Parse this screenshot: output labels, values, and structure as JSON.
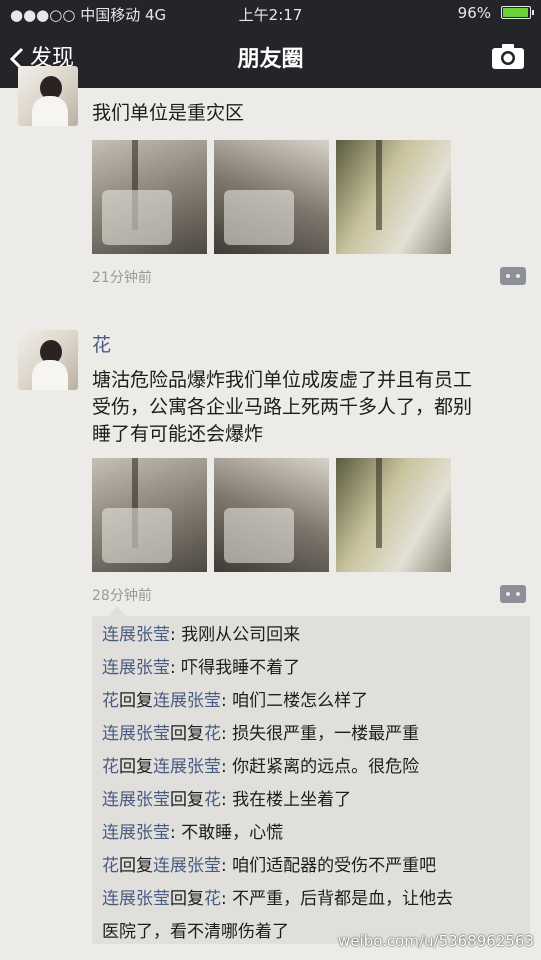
{
  "status_bar": {
    "carrier": "●●●○○ 中国移动 4G",
    "time": "上午2:17",
    "battery": "96%",
    "battery_fraction": 0.96
  },
  "nav": {
    "back_label": "发现",
    "title": "朋友圈"
  },
  "posts": [
    {
      "text": "我们单位是重灾区",
      "timestamp": "21分钟前"
    },
    {
      "name": "花",
      "text_lines": [
        "塘沽危险品爆炸我们单位成废虚了并且有员工",
        "受伤，公寓各企业马路上死两千多人了，都别",
        "睡了有可能还会爆炸"
      ],
      "timestamp": "28分钟前"
    }
  ],
  "comments": [
    {
      "from": "连展张莹",
      "reply_word": "",
      "to": "",
      "text": ": 我刚从公司回来"
    },
    {
      "from": "连展张莹",
      "reply_word": "",
      "to": "",
      "text": ": 吓得我睡不着了"
    },
    {
      "from": "花",
      "reply_word": "回复",
      "to": "连展张莹",
      "text": ": 咱们二楼怎么样了"
    },
    {
      "from": "连展张莹",
      "reply_word": "回复",
      "to": "花",
      "text": ": 损失很严重，一楼最严重"
    },
    {
      "from": "花",
      "reply_word": "回复",
      "to": "连展张莹",
      "text": ": 你赶紧离的远点。很危险"
    },
    {
      "from": "连展张莹",
      "reply_word": "回复",
      "to": "花",
      "text": ": 我在楼上坐着了"
    },
    {
      "from": "连展张莹",
      "reply_word": "",
      "to": "",
      "text": ": 不敢睡，心慌"
    },
    {
      "from": "花",
      "reply_word": "回复",
      "to": "连展张莹",
      "text": ": 咱们适配器的受伤不严重吧"
    },
    {
      "from": "连展张莹",
      "reply_word": "回复",
      "to": "花",
      "text": ": 不严重，后背都是血，让他去"
    },
    {
      "from": "",
      "reply_word": "",
      "to": "",
      "text": "医院了，看不清哪伤着了"
    }
  ],
  "watermark": "weibo.com/u/5368962563",
  "colors": {
    "nav_bg": "#242529",
    "name_blue": "#4a5c82",
    "page_bg": "#ecebe8"
  }
}
